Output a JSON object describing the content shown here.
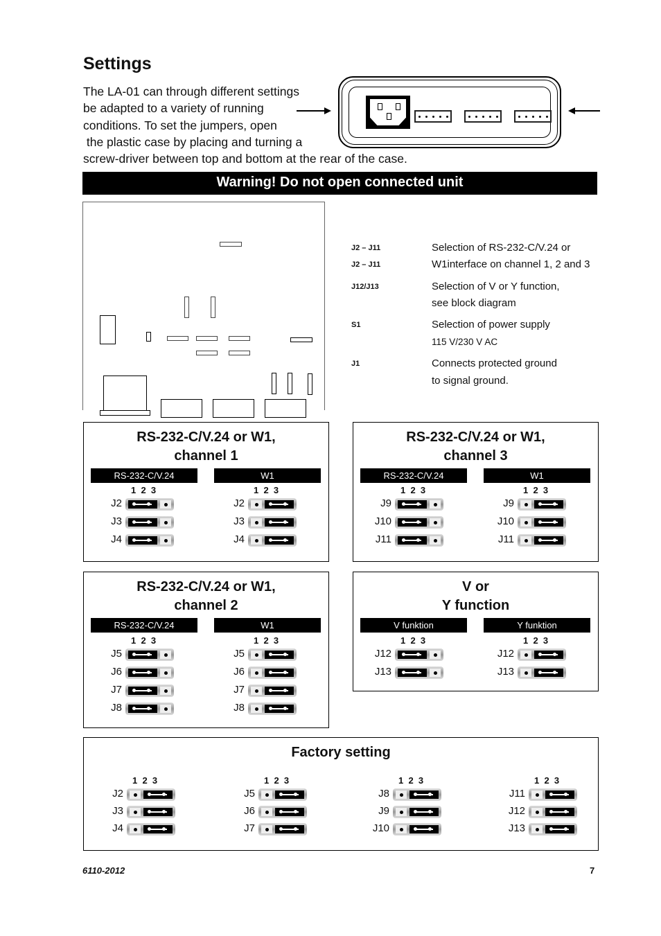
{
  "header": {
    "title": "Settings",
    "intro_lines": [
      "The LA-01 can through different settings",
      "be adapted to a variety of running",
      "conditions. To set the jumpers, open",
      " the plastic case by placing and turning a",
      "screw-driver between top and bottom at the rear of the case."
    ]
  },
  "warning": "Warning! Do not open connected unit",
  "legend": [
    {
      "key": "J2 – J11",
      "value": "Selection of RS-232-C/V.24 or"
    },
    {
      "key": "J2 – J11",
      "value": "W1interface on channel 1, 2 and 3"
    },
    {
      "key": "J12/J13",
      "value": "Selection of V or Y function,"
    },
    {
      "key": "",
      "value": "see block diagram"
    },
    {
      "key": "S1",
      "value": "Selection of power supply"
    },
    {
      "key": "",
      "value": "115 V/230 V AC"
    },
    {
      "key": "J1",
      "value": "Connects protected ground"
    },
    {
      "key": "",
      "value": "to signal ground."
    }
  ],
  "pin_numbers": "1  2  3",
  "panels": {
    "channel1": {
      "title_line1": "RS-232-C/V.24 or W1,",
      "title_line2": "channel 1",
      "left_label": "RS-232-C/V.24",
      "right_label": "W1",
      "jumpers": [
        "J2",
        "J3",
        "J4"
      ],
      "left_position": "1-2",
      "right_position": "2-3"
    },
    "channel3": {
      "title_line1": "RS-232-C/V.24 or W1,",
      "title_line2": "channel 3",
      "left_label": "RS-232-C/V.24",
      "right_label": "W1",
      "jumpers": [
        "J9",
        "J10",
        "J11"
      ],
      "left_position": "1-2",
      "right_position": "2-3"
    },
    "channel2": {
      "title_line1": "RS-232-C/V.24 or W1,",
      "title_line2": "channel 2",
      "left_label": "RS-232-C/V.24",
      "right_label": "W1",
      "jumpers": [
        "J5",
        "J6",
        "J7",
        "J8"
      ],
      "left_position": "1-2",
      "right_position": "2-3"
    },
    "vy": {
      "title_line1": "V or",
      "title_line2": "Y function",
      "left_label": "V funktion",
      "right_label": "Y funktion",
      "jumpers": [
        "J12",
        "J13"
      ],
      "left_position": "1-2",
      "right_position": "2-3"
    }
  },
  "factory": {
    "title": "Factory setting",
    "groups": [
      {
        "jumpers": [
          "J2",
          "J3",
          "J4"
        ],
        "position": "2-3"
      },
      {
        "jumpers": [
          "J5",
          "J6",
          "J7"
        ],
        "position": "2-3"
      },
      {
        "jumpers": [
          "J8",
          "J9",
          "J10"
        ],
        "position": "2-3"
      },
      {
        "jumpers": [
          "J11",
          "J12",
          "J13"
        ],
        "position": "2-3"
      }
    ]
  },
  "footer": {
    "doc_number": "6110-2012",
    "page": "7"
  }
}
